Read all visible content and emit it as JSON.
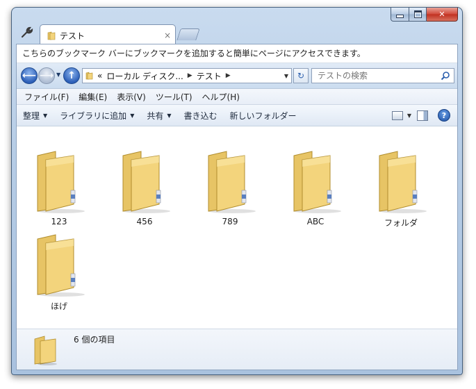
{
  "tab": {
    "title": "テスト",
    "close_glyph": "×"
  },
  "bookmark_message": "こちらのブックマーク バーにブックマークを追加すると簡単にページにアクセスできます。",
  "address": {
    "prefix": "«",
    "segments": [
      "ローカル ディスク...",
      "テスト"
    ]
  },
  "search": {
    "placeholder": "テストの検索"
  },
  "menu": [
    "ファイル(F)",
    "編集(E)",
    "表示(V)",
    "ツール(T)",
    "ヘルプ(H)"
  ],
  "toolbar": {
    "organize": "整理",
    "add_to_library": "ライブラリに追加",
    "share": "共有",
    "burn": "書き込む",
    "new_folder": "新しいフォルダー"
  },
  "items": [
    {
      "name": "123",
      "kind": "empty"
    },
    {
      "name": "456",
      "kind": "empty"
    },
    {
      "name": "789",
      "kind": "empty"
    },
    {
      "name": "ABC",
      "kind": "docs"
    },
    {
      "name": "フォルダ",
      "kind": "empty"
    },
    {
      "name": "ほげ",
      "kind": "docs"
    }
  ],
  "status_text": "6 個の項目",
  "colors": {
    "folder_front": "#f3d47c",
    "folder_back": "#e7c465",
    "accent": "#2c5fb8"
  }
}
